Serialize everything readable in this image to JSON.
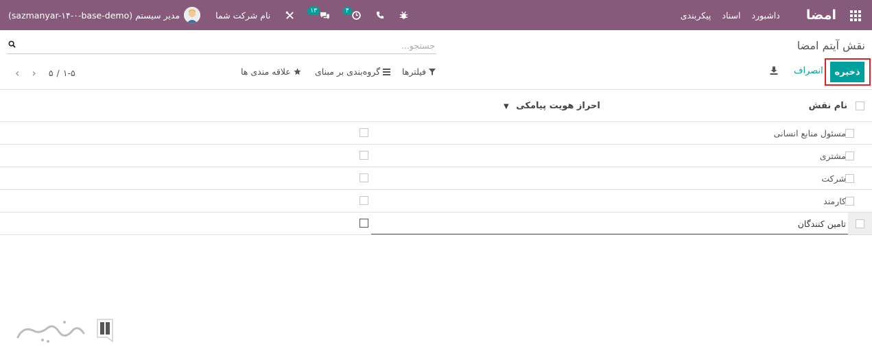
{
  "navbar": {
    "brand": "امضا",
    "menu": [
      "داشبورد",
      "اسناد",
      "پیکربندی"
    ],
    "company": "نام شرکت شما",
    "activity_count": "۴",
    "message_count": "۱۳",
    "user": "مدیر سیستم (sazmanyar-۱۴-۰-base-demo)"
  },
  "control_panel": {
    "breadcrumb": "نقش آیتم امضا",
    "search_placeholder": "جستجو...",
    "save_label": "ذخیره",
    "discard_label": "انصراف",
    "filters_label": "فیلترها",
    "groupby_label": "گروه‌بندی بر مبنای",
    "favorites_label": "علاقه مندی ها",
    "pager_value": "۱-۵",
    "pager_sep": "/",
    "pager_total": "۵"
  },
  "table": {
    "headers": {
      "name": "نام نقش",
      "otp": "احراز هویت پیامکی"
    },
    "rows": [
      {
        "name": "مسئول منابع انسانی"
      },
      {
        "name": "مشتری"
      },
      {
        "name": "شرکت"
      },
      {
        "name": "کارمند"
      },
      {
        "name": "تامین کنندگان"
      }
    ]
  },
  "colors": {
    "navbar": "#875a7b",
    "primary": "#00a09d",
    "highlight": "#e0201f"
  },
  "icons": [
    "apps-icon",
    "bug-icon",
    "phone-icon",
    "clock-icon",
    "chat-icon",
    "tools-icon",
    "search-icon",
    "download-icon",
    "filter-icon",
    "list-icon",
    "star-icon",
    "chevron-left-icon",
    "chevron-right-icon"
  ]
}
